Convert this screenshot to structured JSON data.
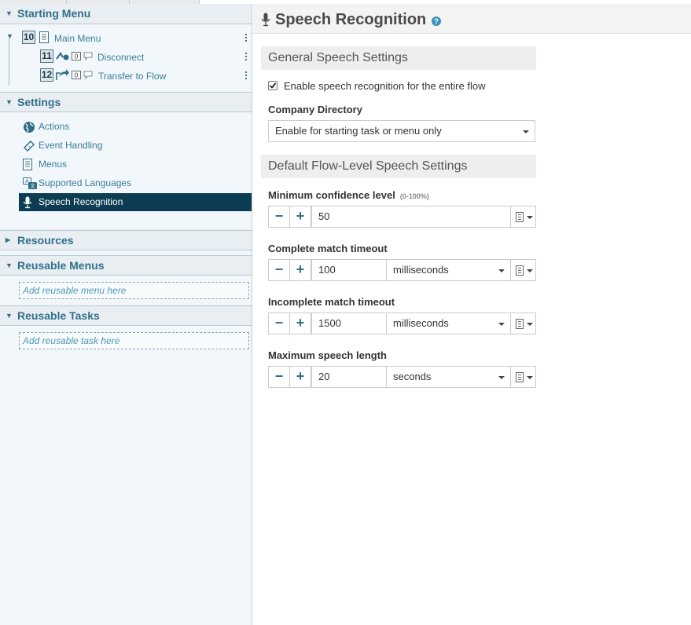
{
  "sidebar": {
    "starting_menu": {
      "header": "Starting Menu",
      "items": [
        {
          "number": "10",
          "label": "Main Menu"
        },
        {
          "number": "11",
          "label": "Disconnect"
        },
        {
          "number": "12",
          "label": "Transfer to Flow"
        }
      ]
    },
    "settings": {
      "header": "Settings",
      "items": [
        {
          "label": "Actions",
          "icon": "globe-icon"
        },
        {
          "label": "Event Handling",
          "icon": "ticket-icon"
        },
        {
          "label": "Menus",
          "icon": "list-icon"
        },
        {
          "label": "Supported Languages",
          "icon": "language-icon"
        },
        {
          "label": "Speech Recognition",
          "icon": "microphone-icon",
          "active": true
        }
      ]
    },
    "resources": {
      "header": "Resources"
    },
    "reusable_menus": {
      "header": "Reusable Menus",
      "add_placeholder": "Add reusable menu here"
    },
    "reusable_tasks": {
      "header": "Reusable Tasks",
      "add_placeholder": "Add reusable task here"
    }
  },
  "main": {
    "title": "Speech Recognition",
    "help_icon": "?",
    "general": {
      "title": "General Speech Settings",
      "enable_label": "Enable speech recognition for the entire flow",
      "enable_checked": true,
      "company_directory_label": "Company Directory",
      "company_directory_value": "Enable for starting task or menu only"
    },
    "defaults": {
      "title": "Default Flow-Level Speech Settings",
      "min_confidence": {
        "label": "Minimum confidence level",
        "hint": "(0-100%)",
        "value": "50"
      },
      "complete_timeout": {
        "label": "Complete match timeout",
        "value": "100",
        "unit": "milliseconds"
      },
      "incomplete_timeout": {
        "label": "Incomplete match timeout",
        "value": "1500",
        "unit": "milliseconds"
      },
      "max_speech": {
        "label": "Maximum speech length",
        "value": "20",
        "unit": "seconds"
      }
    }
  },
  "colors": {
    "accent": "#326f8c",
    "active_bg": "#0d3d52",
    "link": "#3a7d99"
  }
}
